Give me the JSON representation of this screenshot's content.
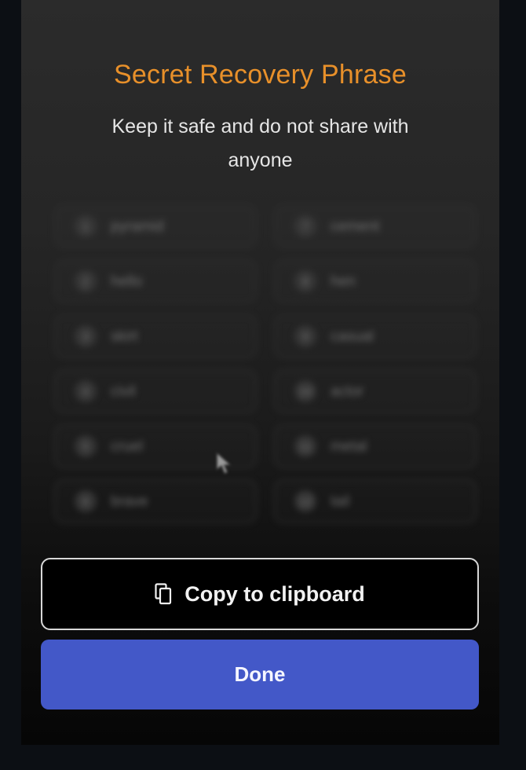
{
  "modal": {
    "title": "Secret Recovery Phrase",
    "subtitle": "Keep it safe and do not share with anyone"
  },
  "words": [
    {
      "index": "1",
      "word": "pyramid"
    },
    {
      "index": "2",
      "word": "hello"
    },
    {
      "index": "3",
      "word": "skirt"
    },
    {
      "index": "4",
      "word": "civil"
    },
    {
      "index": "5",
      "word": "cruel"
    },
    {
      "index": "6",
      "word": "brave"
    },
    {
      "index": "7",
      "word": "cement"
    },
    {
      "index": "8",
      "word": "hen"
    },
    {
      "index": "9",
      "word": "casual"
    },
    {
      "index": "10",
      "word": "actor"
    },
    {
      "index": "11",
      "word": "metal"
    },
    {
      "index": "12",
      "word": "tail"
    }
  ],
  "buttons": {
    "copy_label": "Copy to clipboard",
    "copy_icon": "copy-icon",
    "done_label": "Done"
  },
  "colors": {
    "title": "#e8902a",
    "primary": "#4358c8"
  }
}
